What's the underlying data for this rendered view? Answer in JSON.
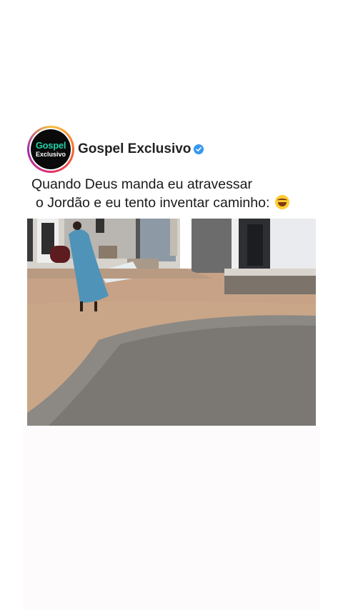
{
  "post": {
    "avatar_line1": "Gospel",
    "avatar_line2": "Exclusivo",
    "account_name": "Gospel Exclusivo",
    "verified_icon": "verified-check-icon",
    "caption_line1": "Quando Deus manda eu atravessar",
    "caption_line2": "o Jordão e eu tento inventar caminho:",
    "caption_emoji": "tears-of-joy-emoji"
  },
  "colors": {
    "avatar_accent": "#1fd0a6",
    "verified": "#3897f0",
    "text": "#1a1a1a"
  }
}
